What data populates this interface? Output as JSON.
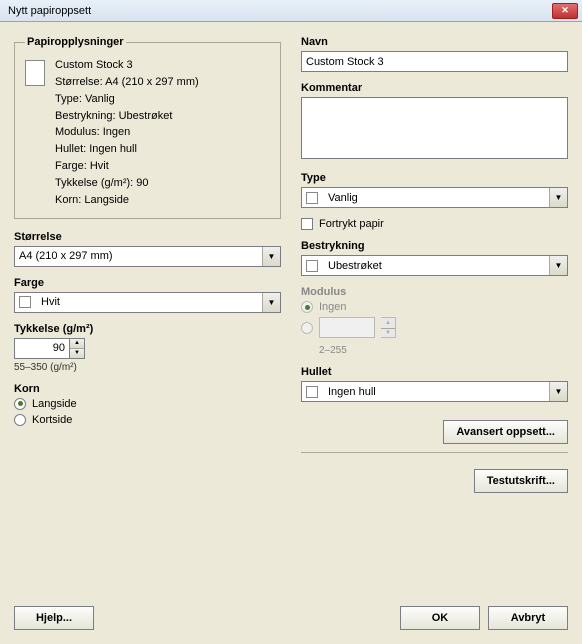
{
  "window": {
    "title": "Nytt papiroppsett"
  },
  "paperinfo": {
    "legend": "Papiropplysninger",
    "name": "Custom Stock 3",
    "size_line": "Størrelse: A4 (210 x 297 mm)",
    "type_line": "Type: Vanlig",
    "coating_line": "Bestrykning: Ubestrøket",
    "modulus_line": "Modulus: Ingen",
    "punch_line": "Hullet: Ingen hull",
    "color_line": "Farge: Hvit",
    "weight_line": "Tykkelse (g/m²): 90",
    "grain_line": "Korn: Langside"
  },
  "leftcol": {
    "size_label": "Størrelse",
    "size_value": "A4 (210 x 297 mm)",
    "color_label": "Farge",
    "color_value": "Hvit",
    "weight_label": "Tykkelse (g/m²)",
    "weight_value": "90",
    "weight_hint": "55–350 (g/m²)",
    "grain_label": "Korn",
    "grain_long": "Langside",
    "grain_short": "Kortside"
  },
  "rightcol": {
    "name_label": "Navn",
    "name_value": "Custom Stock 3",
    "comment_label": "Kommentar",
    "comment_value": "",
    "type_label": "Type",
    "type_value": "Vanlig",
    "preprinted_label": "Fortrykt papir",
    "coating_label": "Bestrykning",
    "coating_value": "Ubestrøket",
    "modulus_label": "Modulus",
    "modulus_none": "Ingen",
    "modulus_value": "",
    "modulus_hint": "2–255",
    "punch_label": "Hullet",
    "punch_value": "Ingen hull"
  },
  "buttons": {
    "advanced": "Avansert oppsett...",
    "testprint": "Testutskrift...",
    "help": "Hjelp...",
    "ok": "OK",
    "cancel": "Avbryt"
  }
}
